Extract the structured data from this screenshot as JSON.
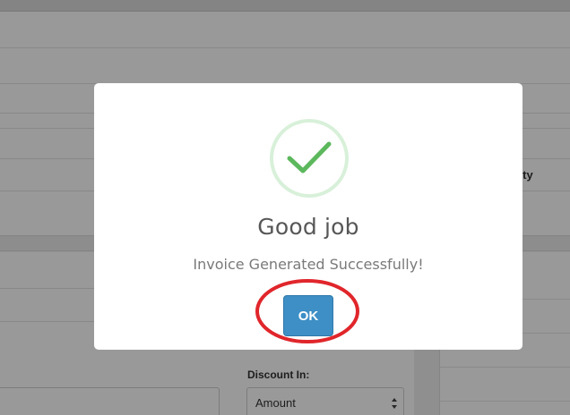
{
  "background": {
    "table_header_quantity": "antity",
    "discount_label": "Discount In:",
    "discount_select": {
      "selected": "Amount"
    }
  },
  "modal": {
    "icon": "success-checkmark-icon",
    "title": "Good job",
    "message": "Invoice Generated Successfully!",
    "ok_label": "OK"
  },
  "annotation": {
    "type": "highlight-ellipse",
    "target": "ok-button",
    "color": "#e0262b"
  },
  "colors": {
    "success_green": "#5cb85c",
    "success_ring": "#d8f0d9",
    "button_blue": "#3d8fc6",
    "highlight_red": "#e0262b"
  }
}
